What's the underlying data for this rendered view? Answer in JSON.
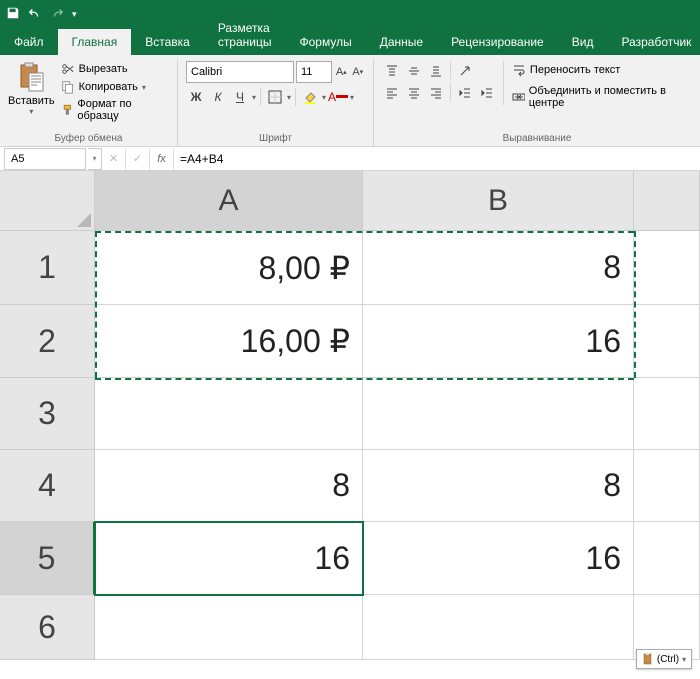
{
  "titlebar": {
    "save_icon": "save",
    "undo_icon": "undo",
    "redo_icon": "redo"
  },
  "tabs": {
    "file": "Файл",
    "home": "Главная",
    "insert": "Вставка",
    "layout": "Разметка страницы",
    "formulas": "Формулы",
    "data": "Данные",
    "review": "Рецензирование",
    "view": "Вид",
    "developer": "Разработчик"
  },
  "ribbon": {
    "paste": "Вставить",
    "cut": "Вырезать",
    "copy": "Копировать",
    "format_painter": "Формат по образцу",
    "clipboard_group": "Буфер обмена",
    "font_name": "Calibri",
    "font_size": "11",
    "bold": "Ж",
    "italic": "К",
    "underline": "Ч",
    "font_group": "Шрифт",
    "wrap_text": "Переносить текст",
    "merge_center": "Объединить и поместить в центре",
    "align_group": "Выравнивание"
  },
  "formula_bar": {
    "cell_ref": "A5",
    "formula": "=A4+B4"
  },
  "grid": {
    "cols": [
      "A",
      "B"
    ],
    "rows": [
      "1",
      "2",
      "3",
      "4",
      "5",
      "6"
    ],
    "cells": {
      "A1": "8,00 ₽",
      "B1": "8",
      "A2": "16,00 ₽",
      "B2": "16",
      "A3": "",
      "B3": "",
      "A4": "8",
      "B4": "8",
      "A5": "16",
      "B5": "16"
    },
    "selected": "A5",
    "copy_range": "A1:B2"
  },
  "paste_options": {
    "label": "(Ctrl)"
  }
}
